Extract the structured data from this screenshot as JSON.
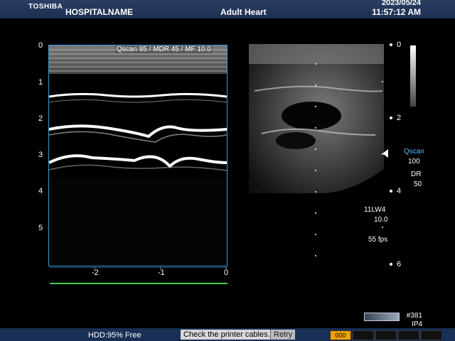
{
  "header": {
    "brand": "TOSHIBA",
    "hospital": "HOSPITALNAME",
    "preset": "Adult Heart",
    "date": "2023/05/24",
    "time": "11:57:12 AM"
  },
  "mmode": {
    "overlay_text": "Qscan 95 / MDR 45 / MF 10.0",
    "depth_labels": [
      "0",
      "1",
      "2",
      "3",
      "4",
      "5"
    ],
    "time_labels": [
      "-2",
      "-1",
      "0"
    ]
  },
  "bmode": {
    "depth_labels": [
      "0",
      "2",
      "4",
      "6"
    ],
    "qscan_label": "Qscan",
    "qscan_value": "100",
    "dr_label": "DR",
    "dr_value": "50",
    "probe": "11LW4",
    "frequency": "10.0",
    "fps": "55 fps"
  },
  "footer": {
    "frame": "#381",
    "ip": "IP4",
    "hdd": "HDD:95% Free",
    "printer_message": "Check the printer cables.",
    "retry_label": "Retry",
    "active_slot": "000"
  },
  "colors": {
    "header_bg": "#1d2f52",
    "status_bg": "#1a2f55",
    "mmode_border": "#3a9ad8",
    "qscan_color": "#5ab8ff",
    "timeline_green": "#3fce4f",
    "active_slot": "#f0a000"
  }
}
